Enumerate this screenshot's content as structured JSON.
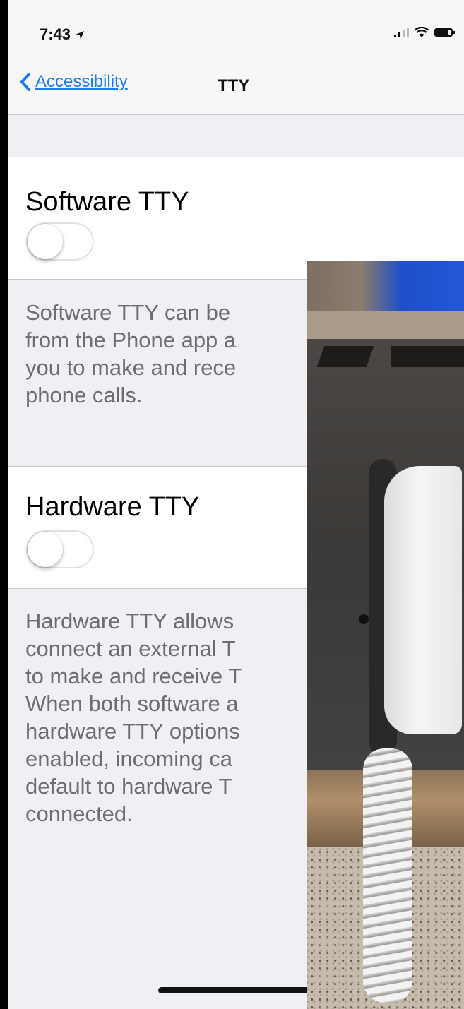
{
  "status_bar": {
    "time": "7:43",
    "location_icon": "location-arrow-icon",
    "signal_icon": "cellular-signal-icon",
    "wifi_icon": "wifi-icon",
    "battery_icon": "battery-icon"
  },
  "nav": {
    "back_label": "Accessibility",
    "back_icon": "chevron-left-icon",
    "title": "TTY"
  },
  "settings": {
    "software_tty": {
      "label": "Software TTY",
      "enabled": false,
      "footer": "Software TTY can be\nfrom the Phone app a\nyou to make and rece\nphone calls."
    },
    "hardware_tty": {
      "label": "Hardware TTY",
      "enabled": false,
      "footer": "Hardware TTY allows\nconnect an external T\nto make and receive T\nWhen both software a\nhardware TTY options\nenabled, incoming ca\ndefault to hardware T\nconnected."
    }
  },
  "colors": {
    "accent": "#1a7cf0",
    "background": "#efeff4",
    "footer_text": "#6d6d72"
  }
}
